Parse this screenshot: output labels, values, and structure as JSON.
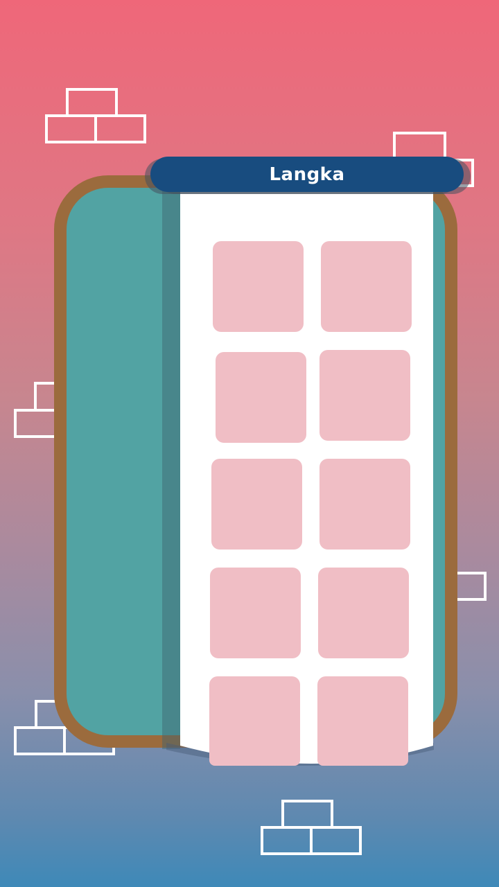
{
  "game": {
    "title": "Langka",
    "tile_count": 10
  },
  "colors": {
    "background_top": "#ef6779",
    "background_bottom": "#3e89b8",
    "frame": "#9b6b3d",
    "board": "#52a3a3",
    "page": "#ffffff",
    "title_bar": "#184c7f",
    "tile": "#f0bec5",
    "decoration_outline": "#ffffff"
  },
  "decorations": {
    "icon": "brick-icon"
  }
}
